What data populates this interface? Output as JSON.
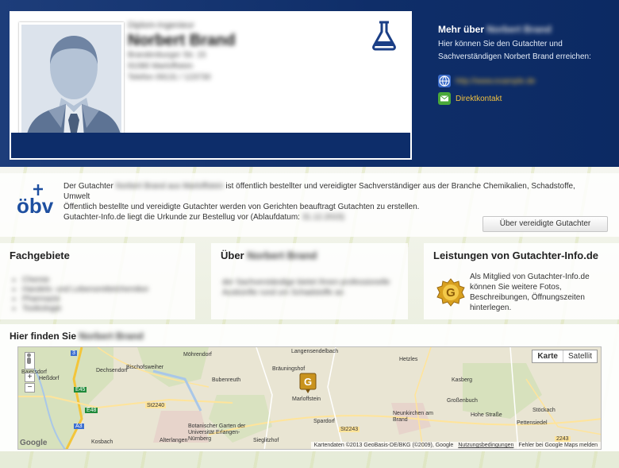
{
  "header": {
    "person": {
      "title": "Diplom-Ingenieur",
      "name": "Norbert Brand",
      "street": "Brandenburger Str. 15",
      "city": "91080 Marloffstein",
      "phone": "Telefon 09131 / 123730"
    },
    "mehr": {
      "title_prefix": "Mehr über",
      "title_name": "Norbert Brand",
      "text": "Hier können Sie den Gutachter und Sachverständigen Norbert Brand erreichen:"
    },
    "contacts": [
      {
        "icon": "globe-icon",
        "label": "http://www.example.de"
      },
      {
        "icon": "mail-icon",
        "label": "Direktkontakt"
      }
    ]
  },
  "obv": {
    "logo_text": "öbv",
    "line1_a": "Der Gutachter",
    "line1_name": "Norbert Brand",
    "line1_b": "aus Marloffstein",
    "line1_c": "ist öffentlich bestellter und vereidigter Sachverständiger aus der Branche Chemikalien, Schadstoffe, Umwelt",
    "line2": "Öffentlich bestellte und vereidigte Gutachter werden von Gerichten beauftragt Gutachten zu erstellen.",
    "line3_a": "Gutachter-Info.de liegt die Urkunde zur Bestellug vor (Ablaufdatum:",
    "line3_date": "31.12.2015)",
    "button": "Über vereidigte Gutachter"
  },
  "fachgebiete": {
    "title": "Fachgebiete",
    "items": [
      "Chemie",
      "Handels- und Lebensmittelchemiker",
      "Pharmazie",
      "Toxikologie"
    ]
  },
  "ueber": {
    "title_prefix": "Über",
    "title_name": "Norbert Brand",
    "text": "der Sachverständige bietet Ihnen professionelle Auskünfte rund um Schadstoffe an"
  },
  "leistungen": {
    "title": "Leistungen von Gutachter-Info.de",
    "text": "Als Mitglied von Gutachter-Info.de können Sie weitere Fotos, Beschreibungen, Öffnungszeiten hinterlegen.",
    "badge": "G"
  },
  "map": {
    "title_prefix": "Hier finden Sie",
    "title_name": "Norbert Brand",
    "types": [
      "Karte",
      "Satellit"
    ],
    "zoom": [
      "+",
      "−"
    ],
    "labels": [
      "Möhrendorf",
      "Langensendelbach",
      "Hetzles",
      "Dechsendorf",
      "Bräuningshof",
      "Heßdorf",
      "Bubenreuth",
      "Marloffstein",
      "Großenbuch",
      "Baiersdorf",
      "Kosbach",
      "Alterlangen",
      "Botanischer Garten der Universität Erlangen-Nürnberg",
      "Spardorf",
      "Neunkirchen am Brand",
      "Stöckach",
      "Pettensiedel",
      "Sieglitzhof",
      "Hohe Straße",
      "Bischofsweiher",
      "Kasberg"
    ],
    "roads": [
      "3",
      "E45",
      "E48",
      "St2240",
      "A3",
      "St2243",
      "2243"
    ],
    "footer_data": "Kartendaten ©2013 GeoBasis-DE/BKG (©2009), Google",
    "footer_terms": "Nutzungsbedingungen",
    "footer_report": "Fehler bei Google Maps melden",
    "google": "Google"
  },
  "colors": {
    "header_bg": "#0f2e69",
    "accent_gold": "#f0c040",
    "card_bar": "#0d2d6a"
  }
}
